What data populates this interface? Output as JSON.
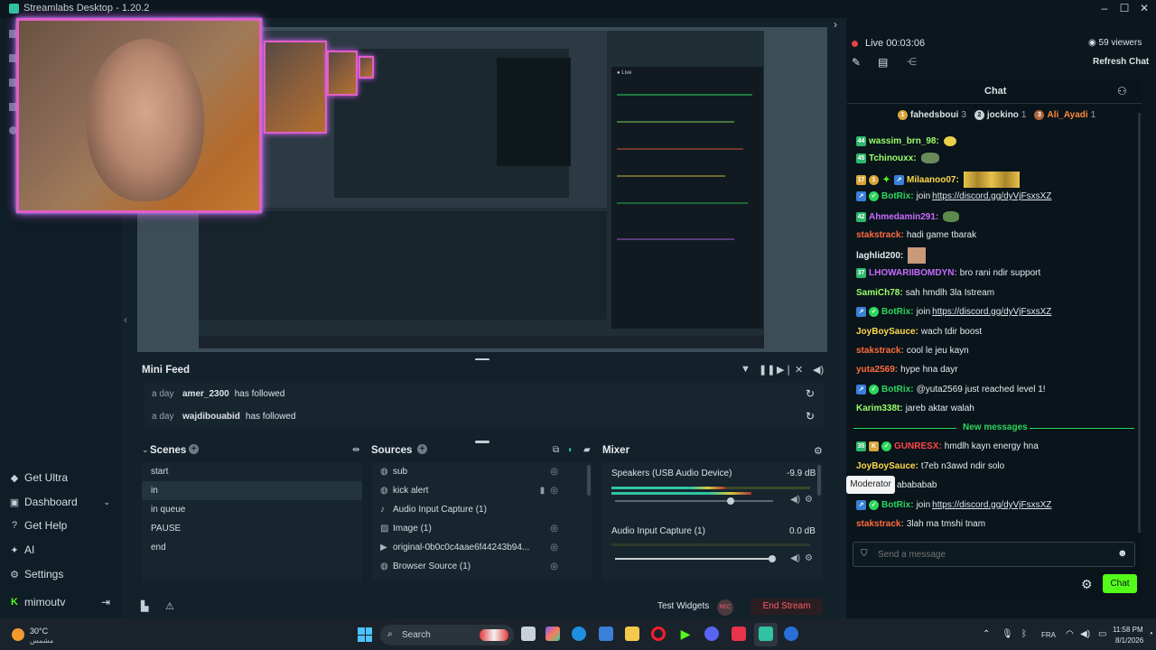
{
  "app": {
    "title": "Streamlabs Desktop - 1.20.2"
  },
  "leftnav": {
    "items": [
      {
        "label": "Get Ultra",
        "icon": "diamond-icon"
      },
      {
        "label": "Dashboard",
        "icon": "dashboard-icon"
      },
      {
        "label": "Get Help",
        "icon": "help-icon"
      },
      {
        "label": "AI",
        "icon": "ai-icon"
      },
      {
        "label": "Settings",
        "icon": "gear-icon"
      }
    ],
    "user": "mimoutv"
  },
  "minifeed": {
    "title": "Mini Feed",
    "rows": [
      {
        "time": "a day",
        "user": "amer_2300",
        "action": "has followed"
      },
      {
        "time": "a day",
        "user": "wajdibouabid",
        "action": "has followed"
      }
    ]
  },
  "scenes": {
    "title": "Scenes",
    "items": [
      "start",
      "in",
      "in queue",
      "PAUSE",
      "end"
    ],
    "selected": "in"
  },
  "sources": {
    "title": "Sources",
    "items": [
      "sub",
      "kick alert",
      "Audio Input Capture (1)",
      "Image (1)",
      "original-0b0c0c4aae6f44243b94...",
      "Browser Source (1)"
    ]
  },
  "mixer": {
    "title": "Mixer",
    "channels": [
      {
        "name": "Speakers (USB Audio Device)",
        "db": "-9.9 dB",
        "level": 0.72
      },
      {
        "name": "Audio Input Capture (1)",
        "db": "0.0 dB",
        "level": 0.0
      }
    ]
  },
  "footer": {
    "test_widgets": "Test Widgets",
    "end_stream": "End Stream",
    "rec": "REC"
  },
  "chat": {
    "live_label": "Live",
    "live_time": "00:03:06",
    "viewers": "59 viewers",
    "refresh": "Refresh Chat",
    "header": "Chat",
    "top": [
      {
        "rank": "1",
        "name": "fahedsboui",
        "count": "3"
      },
      {
        "rank": "2",
        "name": "jockino",
        "count": "1"
      },
      {
        "rank": "3",
        "name": "Ali_Ayadi",
        "count": "1"
      }
    ],
    "messages": [
      {
        "user": "wassim_brn_98:",
        "text": "",
        "color": "#9bff6a",
        "badge": "44"
      },
      {
        "user": "Tchinouxx:",
        "text": "",
        "color": "#9bff6a",
        "badge": "45"
      },
      {
        "user": "Milaanoo07:",
        "text": "",
        "color": "#ffd84a",
        "badge": "17"
      },
      {
        "user": "BotRix:",
        "text": "join ",
        "link": "https://discord.gg/dyVjFsxsXZ",
        "color": "#2cd65b"
      },
      {
        "user": "Ahmedamin291:",
        "text": "",
        "color": "#c76bff",
        "badge": "42"
      },
      {
        "user": "stakstrack:",
        "text": "hadi game tbarak",
        "color": "#ff6b3d"
      },
      {
        "user": "laghlid200:",
        "text": "",
        "color": "#e6ebee"
      },
      {
        "user": "LHOWARIIBOMDYN:",
        "text": "bro rani ndir support",
        "color": "#c76bff",
        "badge": "37"
      },
      {
        "user": "SamiCh78:",
        "text": "sah hmdlh 3la Istream",
        "color": "#9bff6a"
      },
      {
        "user": "BotRix:",
        "text": "join ",
        "link": "https://discord.gg/dyVjFsxsXZ",
        "color": "#2cd65b"
      },
      {
        "user": "JoyBoySauce:",
        "text": "wach tdir boost",
        "color": "#ffd84a"
      },
      {
        "user": "stakstrack:",
        "text": "cool le jeu kayn",
        "color": "#ff6b3d"
      },
      {
        "user": "yuta2569:",
        "text": "hype hna dayr",
        "color": "#ff6b3d"
      },
      {
        "user": "BotRix:",
        "text": "@yuta2569 just reached level 1!",
        "color": "#2cd65b"
      },
      {
        "user": "Karim338t:",
        "text": "jareb aktar walah",
        "color": "#9bff6a"
      }
    ],
    "new_messages": "New messages",
    "new": [
      {
        "user": "GUNRESX:",
        "text": "hmdlh kayn energy hna",
        "color": "#ff4545",
        "badge": "35"
      },
      {
        "user": "JoyBoySauce:",
        "text": "t7eb n3awd ndir solo",
        "color": "#ffd84a"
      },
      {
        "user": "",
        "text": "abababab",
        "color": "#e6ebee"
      },
      {
        "user": "BotRix:",
        "text": "join ",
        "link": "https://discord.gg/dyVjFsxsXZ",
        "color": "#2cd65b"
      },
      {
        "user": "stakstrack:",
        "text": "3lah ma tmshi tnam",
        "color": "#ff6b3d"
      }
    ],
    "tooltip": "Moderator",
    "input_placeholder": "Send a message",
    "send": "Chat"
  },
  "taskbar": {
    "weather_temp": "30°C",
    "weather_desc": "مشمس",
    "search": "Search",
    "lang": "FRA",
    "time": "11:58 PM",
    "date": "8/1/2026"
  }
}
